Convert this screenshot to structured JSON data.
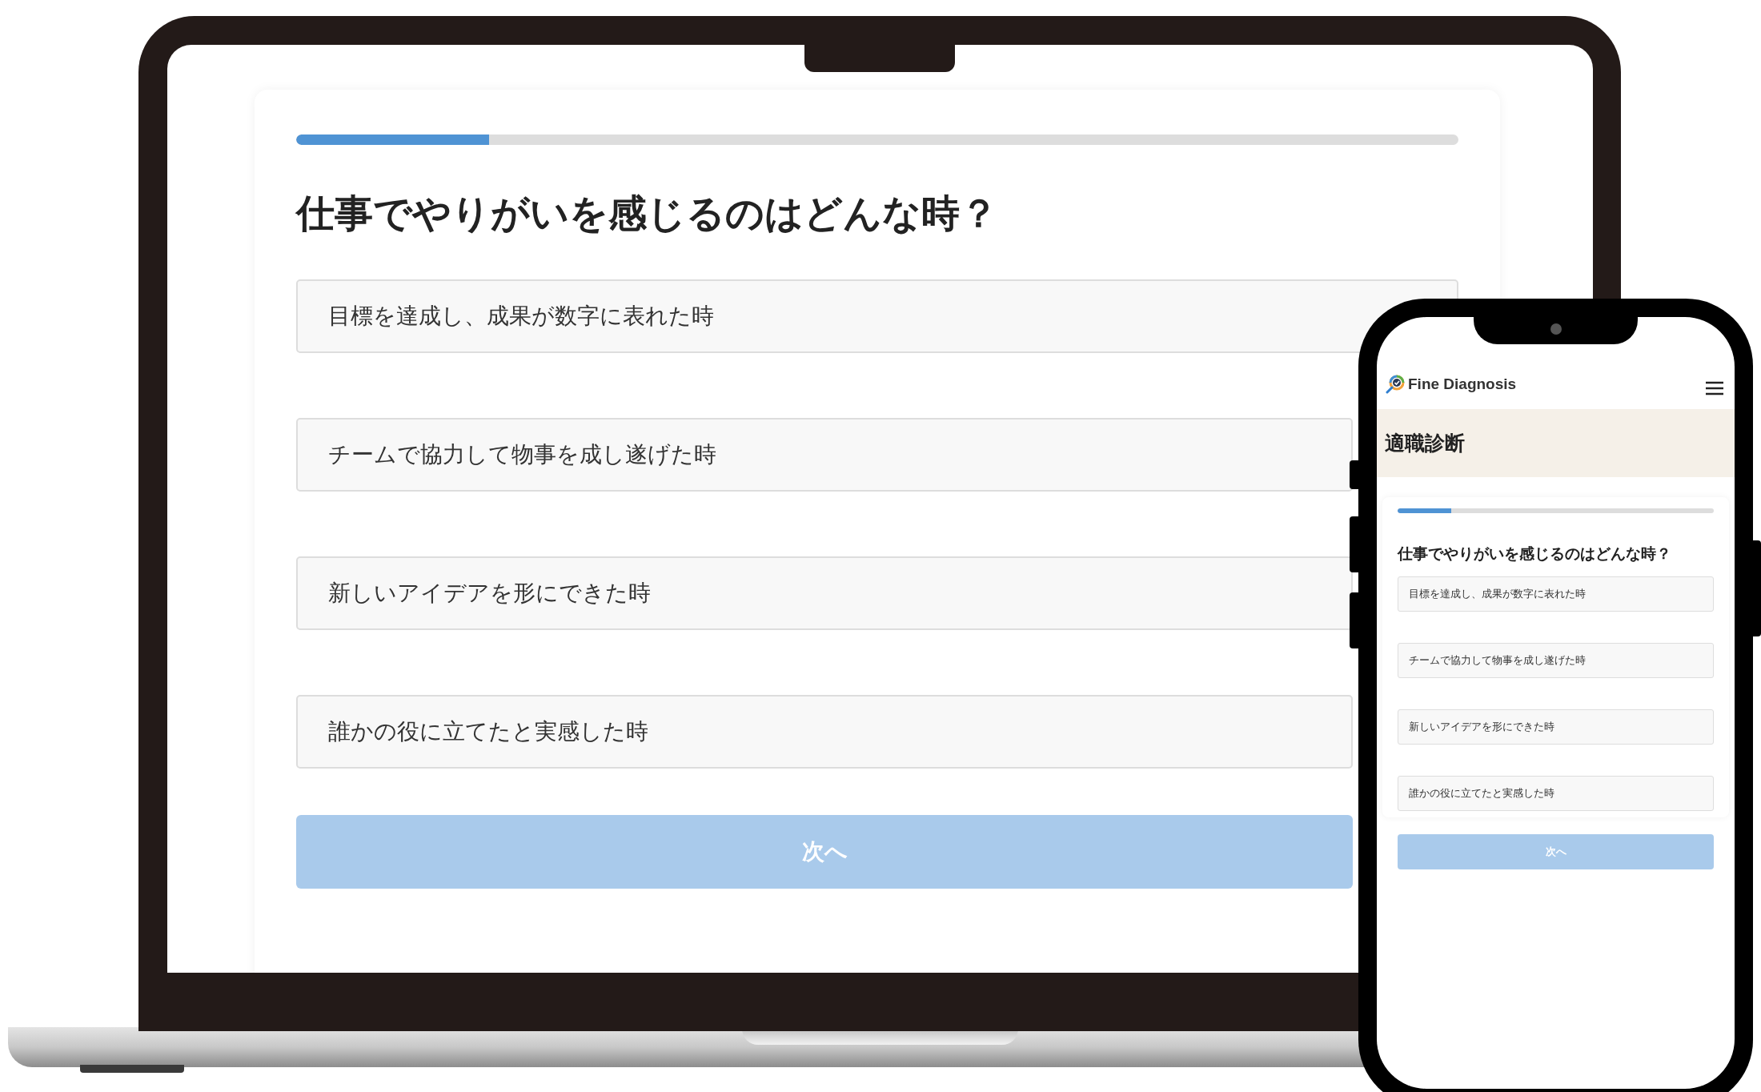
{
  "laptop": {
    "progress": {
      "level": 0.166
    },
    "question": "仕事でやりがいを感じるのはどんな時？",
    "options": [
      {
        "label": "目標を達成し、成果が数字に表れた時"
      },
      {
        "label": "チームで協力して物事を成し遂げた時"
      },
      {
        "label": "新しいアイデアを形にできた時"
      },
      {
        "label": "誰かの役に立てたと実感した時"
      }
    ],
    "next_button": {
      "label": "次へ",
      "disabled": true
    }
  },
  "phone": {
    "brand": "Fine Diagnosis",
    "page_title": "適職診断",
    "progress": {
      "level": 0.17
    },
    "question": "仕事でやりがいを感じるのはどんな時？",
    "options": [
      {
        "label": "目標を達成し、成果が数字に表れた時"
      },
      {
        "label": "チームで協力して物事を成し遂げた時"
      },
      {
        "label": "新しいアイデアを形にできた時"
      },
      {
        "label": "誰かの役に立てたと実感した時"
      }
    ],
    "next_button": {
      "label": "次へ",
      "disabled": true
    }
  }
}
